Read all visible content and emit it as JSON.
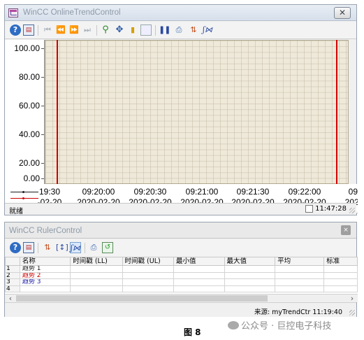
{
  "trend_window": {
    "title": "WinCC OnlineTrendControl",
    "close_glyph": "✕",
    "toolbar_icons": [
      "help-icon",
      "config-icon",
      "first-icon",
      "prev-icon",
      "next-icon",
      "last-icon",
      "zoom-icon",
      "move-icon",
      "ruler-icon",
      "stats-icon",
      "pause-icon",
      "print-icon",
      "select-tags-icon",
      "fx-icon"
    ],
    "y_labels": [
      "100.00",
      "80.00",
      "60.00",
      "40.00",
      "20.00",
      "0.00"
    ],
    "x_labels": [
      {
        "time": "19:30",
        "date": "-02-20"
      },
      {
        "time": "09:20:00",
        "date": "2020-02-20"
      },
      {
        "time": "09:20:30",
        "date": "2020-02-20"
      },
      {
        "time": "09:21:00",
        "date": "2020-02-20"
      },
      {
        "time": "09:21:30",
        "date": "2020-02-20"
      },
      {
        "time": "09:22:00",
        "date": "2020-02-20"
      },
      {
        "time": "09:",
        "date": "2020"
      }
    ],
    "legend_colors": [
      "#1a1a1a",
      "#cc0000",
      "#1a1aaa"
    ],
    "ruler_color": "#d40000",
    "status_text": "就绪",
    "status_time": "11:47:28"
  },
  "ruler_window": {
    "title": "WinCC RulerControl",
    "close_glyph": "×",
    "columns": [
      "",
      "名称",
      "时间戳 (LL)",
      "时间戳 (UL)",
      "最小值",
      "最大值",
      "平均",
      "标准"
    ],
    "rows": [
      {
        "n": "1",
        "name": "趋势 1",
        "color": "#1a1a1a"
      },
      {
        "n": "2",
        "name": "趋势 2",
        "color": "#cc0000"
      },
      {
        "n": "3",
        "name": "趋势 3",
        "color": "#1a1aaa"
      },
      {
        "n": "4",
        "name": "",
        "color": "#1a1a1a"
      }
    ],
    "status_source": "来源:  myTrendCtr  11:19:40"
  },
  "caption": "图 8",
  "watermark": "公众号 · 巨控电子科技"
}
